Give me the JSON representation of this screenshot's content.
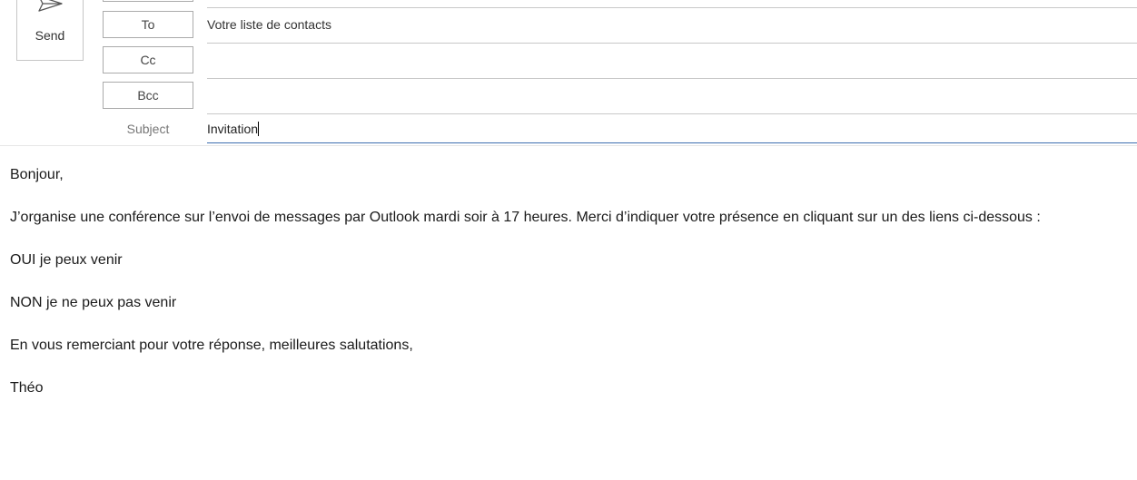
{
  "header": {
    "send_label": "Send",
    "to_label": "To",
    "cc_label": "Cc",
    "bcc_label": "Bcc",
    "subject_label": "Subject",
    "to_value": "Votre liste de contacts",
    "cc_value": "",
    "bcc_value": "",
    "subject_value": "Invitation"
  },
  "body": {
    "paragraphs": [
      "Bonjour,",
      "J’organise une conférence sur l’envoi de messages par Outlook mardi soir à 17 heures. Merci d’indiquer votre présence en cliquant sur un des liens ci-dessous :",
      "OUI je peux venir",
      "NON je ne peux pas venir",
      "En vous remerciant pour votre réponse, meilleures salutations,",
      "Théo"
    ]
  },
  "colors": {
    "subject_underline": "#3d6fb0",
    "field_separator": "#c8c8c8",
    "button_border": "#ababab"
  }
}
